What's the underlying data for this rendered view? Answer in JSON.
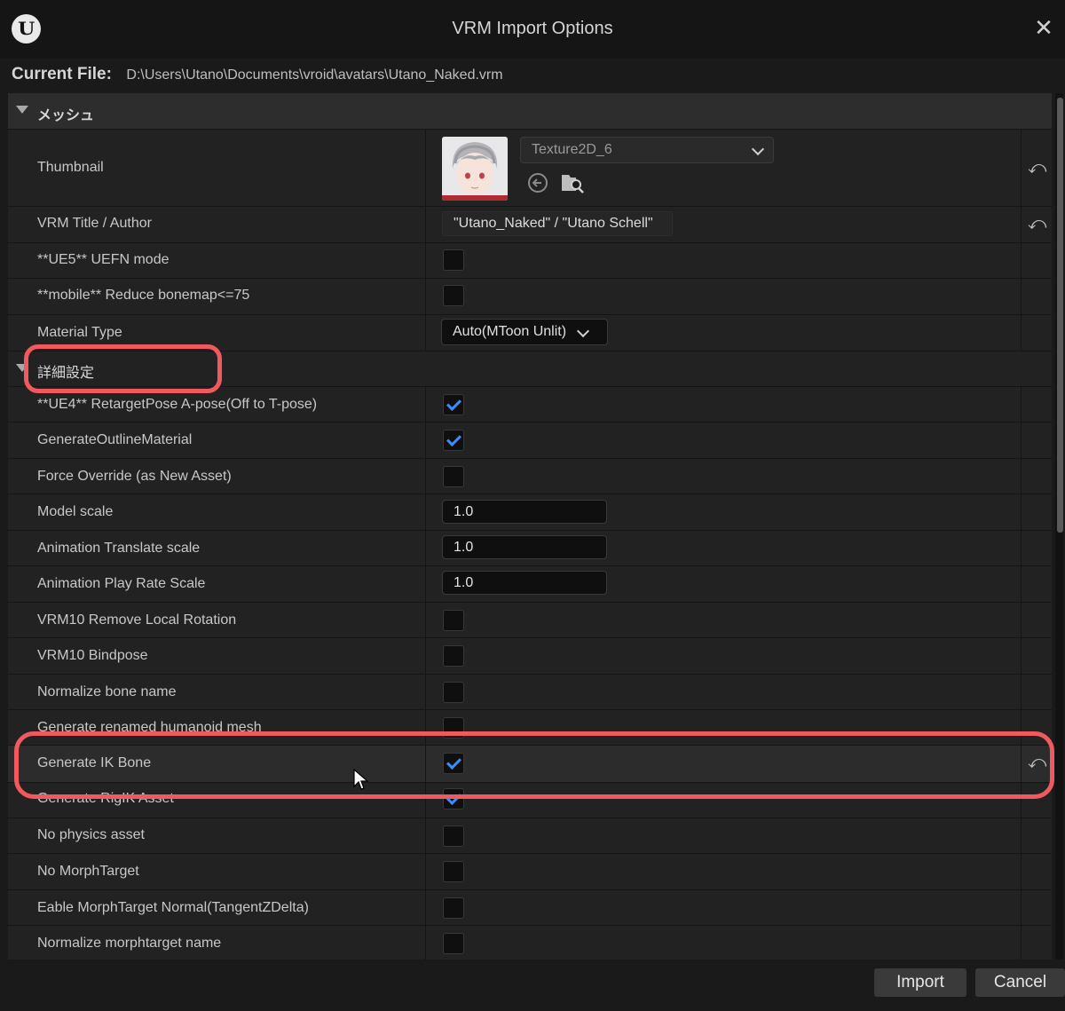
{
  "window": {
    "title": "VRM Import Options",
    "logo_text": "U"
  },
  "current_file": {
    "label": "Current File:",
    "path": "D:\\Users\\Utano\\Documents\\vroid\\avatars\\Utano_Naked.vrm"
  },
  "section_mesh": {
    "title": "メッシュ"
  },
  "thumbnail": {
    "label": "Thumbnail",
    "texture": "Texture2D_6"
  },
  "title_author": {
    "label": "VRM Title / Author",
    "value": "\"Utano_Naked\" / \"Utano Schell\""
  },
  "uefn": {
    "label": "**UE5** UEFN mode",
    "checked": false
  },
  "reduce_bonemap": {
    "label": "**mobile** Reduce bonemap<=75",
    "checked": false
  },
  "material_type": {
    "label": "Material Type",
    "value": "Auto(MToon Unlit)"
  },
  "section_advanced": {
    "title": "詳細設定"
  },
  "options": [
    {
      "label": "**UE4** RetargetPose A-pose(Off to T-pose)",
      "checked": true
    },
    {
      "label": "GenerateOutlineMaterial",
      "checked": true
    },
    {
      "label": "Force Override (as New Asset)",
      "checked": false
    }
  ],
  "scales": [
    {
      "label": "Model scale",
      "value": "1.0"
    },
    {
      "label": "Animation Translate scale",
      "value": "1.0"
    },
    {
      "label": "Animation Play Rate Scale",
      "value": "1.0"
    }
  ],
  "options2": [
    {
      "label": "VRM10 Remove Local Rotation",
      "checked": false
    },
    {
      "label": "VRM10 Bindpose",
      "checked": false
    },
    {
      "label": "Normalize bone name",
      "checked": false
    },
    {
      "label": "Generate renamed humanoid mesh",
      "checked": false
    },
    {
      "label": "Generate IK Bone",
      "checked": true
    },
    {
      "label": "Generate RigIK Asset",
      "checked": true
    },
    {
      "label": "No physics asset",
      "checked": false
    },
    {
      "label": "No MorphTarget",
      "checked": false
    },
    {
      "label": "Eable MorphTarget Normal(TangentZDelta)",
      "checked": false
    },
    {
      "label": "Normalize morphtarget name",
      "checked": false
    }
  ],
  "buttons": {
    "import": "Import",
    "cancel": "Cancel"
  },
  "colors": {
    "accent_check": "#3a8dff",
    "annotation": "#f05a5e"
  }
}
